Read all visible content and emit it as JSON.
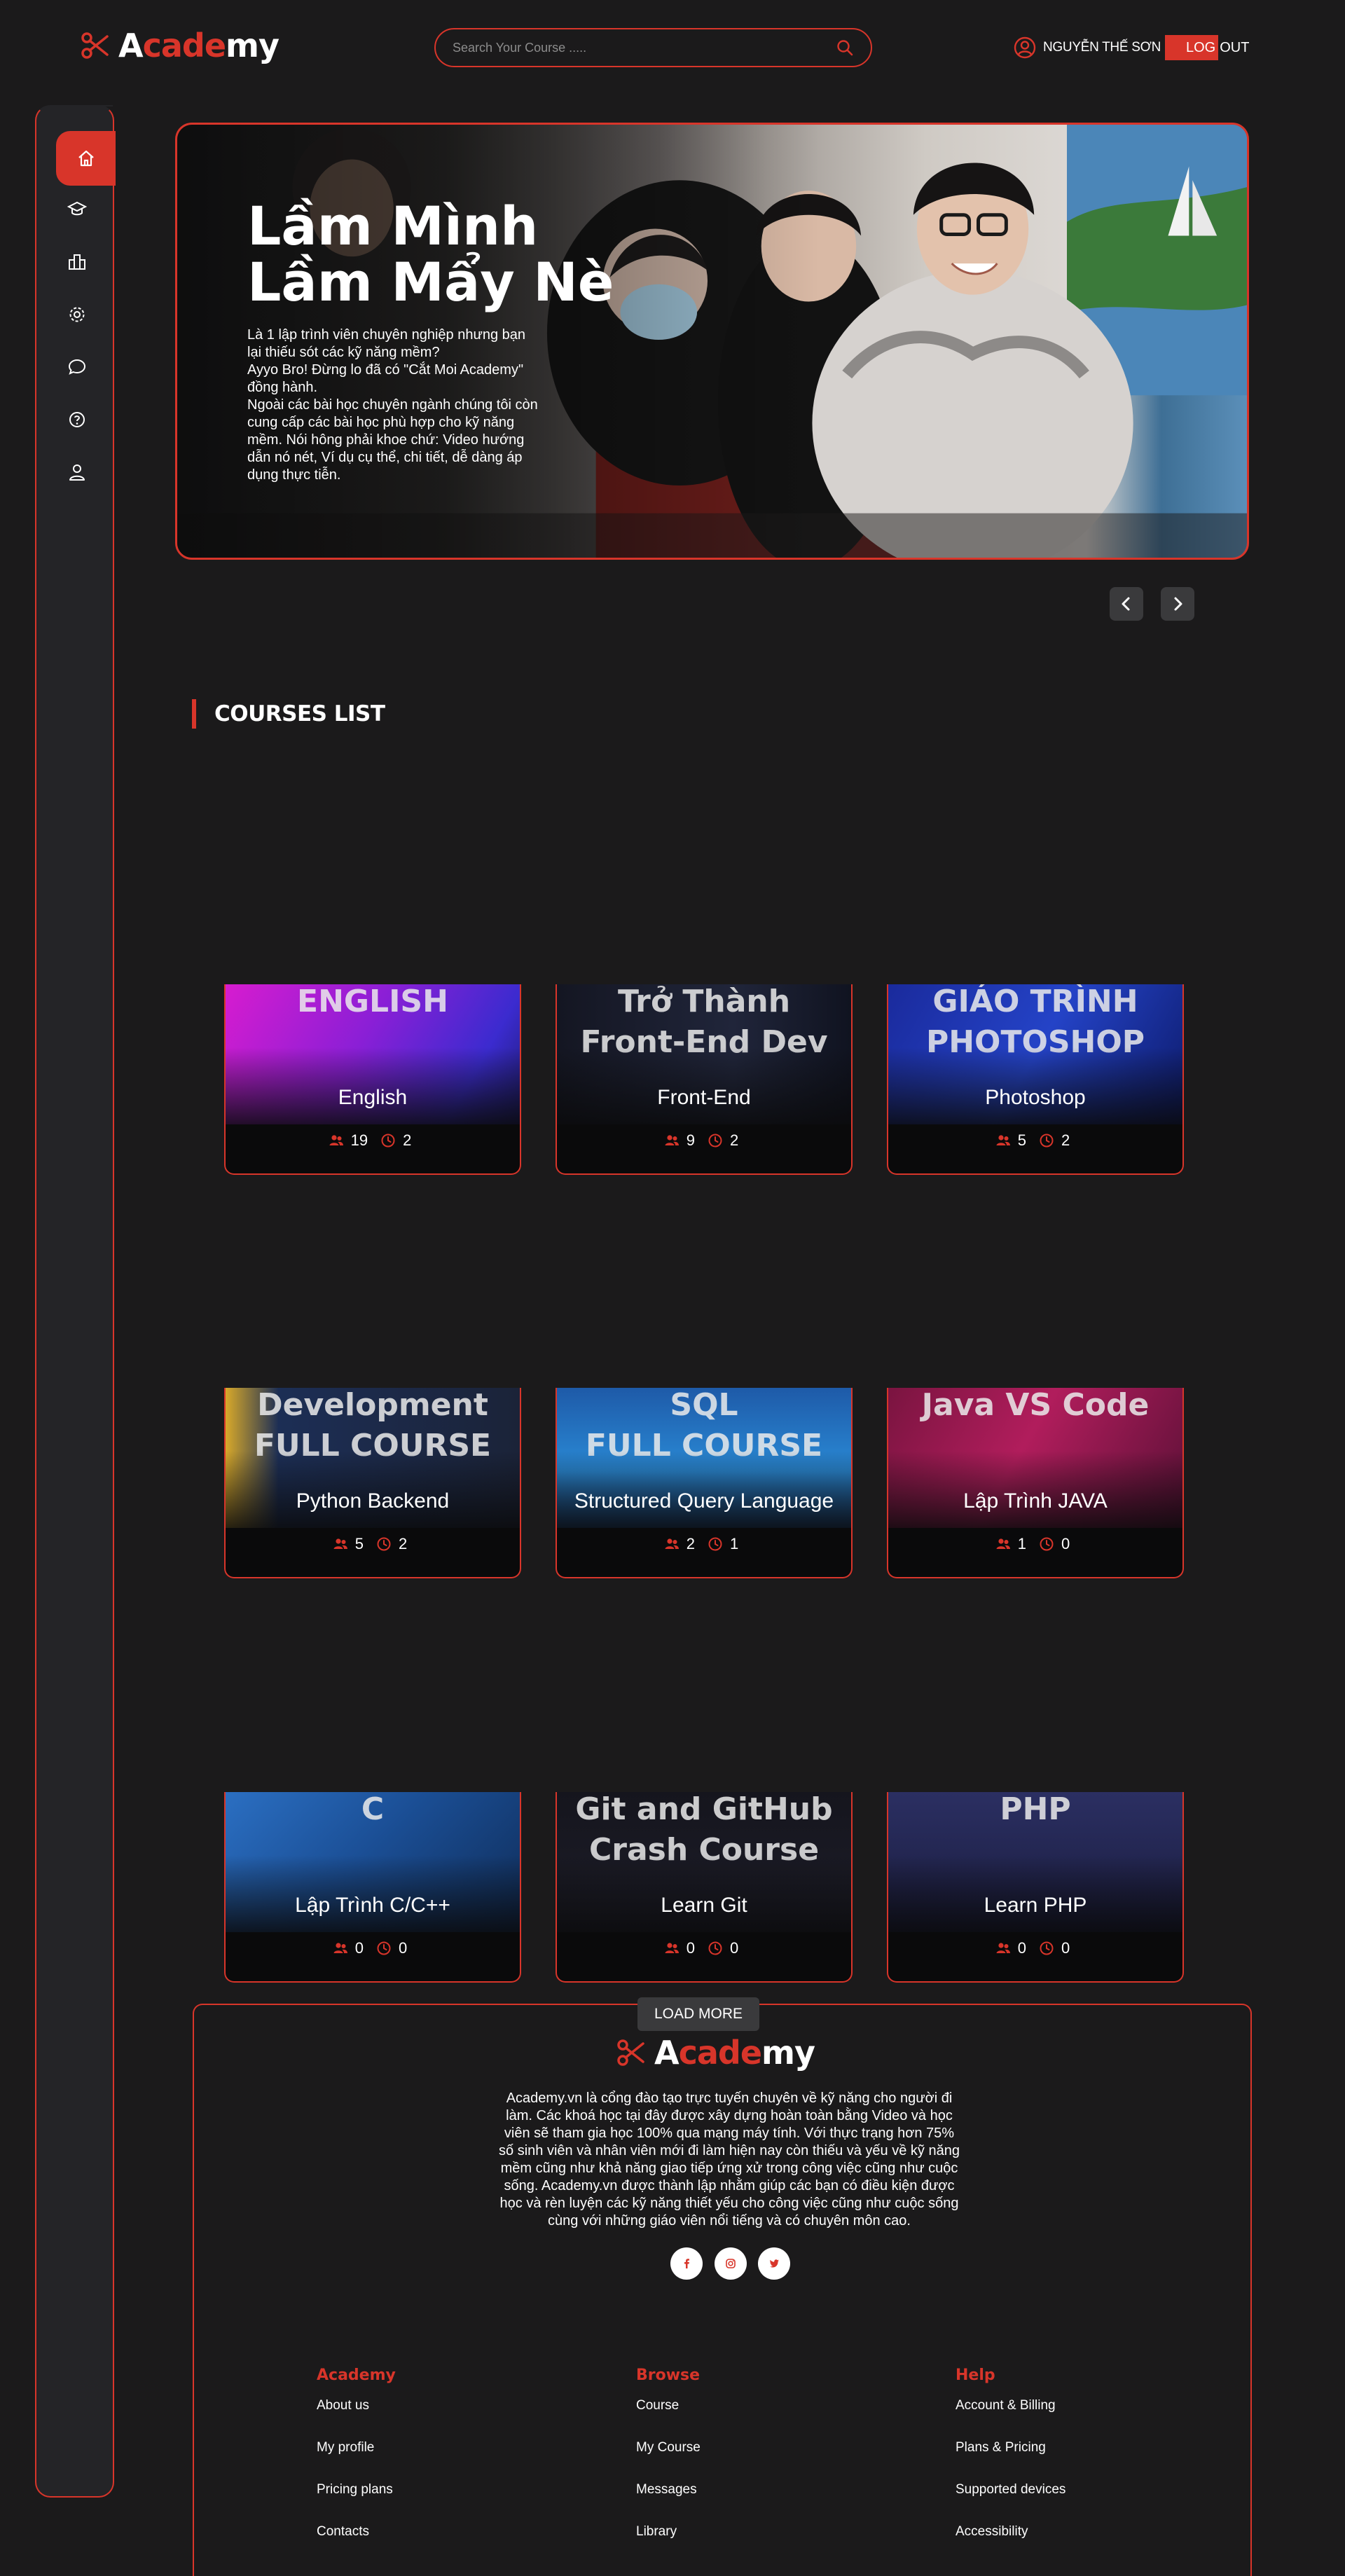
{
  "brand": {
    "part1": "A",
    "part2": "cade",
    "part3": "my"
  },
  "search": {
    "placeholder": "Search Your Course ....."
  },
  "user": {
    "name": "NGUYỄN THẾ SƠN",
    "logout_part1": "LOG",
    "logout_part2": "OUT"
  },
  "sidebar": {
    "items": [
      {
        "name": "home",
        "icon": "home-icon",
        "active": true
      },
      {
        "name": "courses",
        "icon": "graduation-cap-icon"
      },
      {
        "name": "institution",
        "icon": "building-icon"
      },
      {
        "name": "settings",
        "icon": "gear-icon"
      },
      {
        "name": "messages",
        "icon": "chat-icon"
      },
      {
        "name": "help",
        "icon": "question-icon"
      },
      {
        "name": "profile",
        "icon": "user-icon"
      }
    ]
  },
  "hero": {
    "title_line1": "Lầm Mình",
    "title_line2": "Lầm Mẩy Nè",
    "desc_lines": [
      "Là 1 lập trình viên chuyên nghiệp nhưng bạn",
      "lại thiếu sót các kỹ năng mềm?",
      "Ayyo Bro! Đừng lo đã có \"Cắt Moi Academy\"",
      "đồng hành.",
      "Ngoài các bài học chuyên ngành chúng tôi còn",
      "cung cấp các bài học phù hợp cho kỹ năng",
      "mềm. Nói hông phải khoe chứ: Video hướng",
      "dẫn nó nét, Ví dụ cụ thể, chi tiết, dễ dàng áp",
      "dụng thực tiễn."
    ]
  },
  "courses": {
    "title": "COURSES LIST",
    "items": [
      {
        "name": "English",
        "students": "19",
        "lessons": "2",
        "art": "ENGLISH",
        "bg": "linear-gradient(120deg,#d71ccf 0%,#8a1fd6 45%,#3b2bcf 80%,#1e1c73 100%)"
      },
      {
        "name": "Front-End",
        "students": "9",
        "lessons": "2",
        "art": "Trở Thành\nFront-End Dev",
        "bg": "linear-gradient(90deg,#141622 0%,#20253a 60%,#101320 100%)"
      },
      {
        "name": "Photoshop",
        "students": "5",
        "lessons": "2",
        "art": "GIÁO TRÌNH\nPHOTOSHOP",
        "bg": "linear-gradient(120deg,#1a2a9c 0%,#2443c7 50%,#0d1a6a 100%)"
      },
      {
        "name": "Python Backend",
        "students": "5",
        "lessons": "2",
        "art": "Development\nFULL COURSE",
        "bg": "linear-gradient(90deg,#d8a92a 0%,#1c2e55 18%,#1b2338 100%)"
      },
      {
        "name": "Structured Query Language",
        "students": "2",
        "lessons": "1",
        "art": "SQL\nFULL COURSE",
        "bg": "linear-gradient(180deg,#1e5aa8 0%,#2a8ad6 60%,#1b4d8a 100%)"
      },
      {
        "name": "Lập Trình JAVA",
        "students": "1",
        "lessons": "0",
        "art": "Java   VS Code",
        "bg": "linear-gradient(120deg,#7a1440 0%,#b11d5c 45%,#5a1036 100%)"
      },
      {
        "name": "Lập Trình C/C++",
        "students": "0",
        "lessons": "0",
        "art": "C",
        "bg": "linear-gradient(135deg,#2b6fc2 0%,#1b4f96 45%,#0f2c58 100%)"
      },
      {
        "name": "Learn Git",
        "students": "0",
        "lessons": "0",
        "art": "Git and GitHub\nCrash Course",
        "bg": "linear-gradient(180deg,#15151d 0%,#1e1e2a 100%)"
      },
      {
        "name": "Learn PHP",
        "students": "0",
        "lessons": "0",
        "art": "PHP",
        "bg": "linear-gradient(180deg,#2b2f62 0%,#1a1c3e 100%)"
      }
    ],
    "load_more": "LOAD MORE"
  },
  "footer": {
    "description_lines": [
      "Academy.vn là cổng đào tạo trực tuyến chuyên về kỹ năng cho người đi",
      "làm. Các khoá học tại đây được xây dựng hoàn toàn bằng Video và học",
      "viên sẽ tham gia học 100% qua mạng máy tính. Với thực trạng hơn 75%",
      "số sinh viên và nhân viên mới đi làm hiện nay còn thiếu và yếu về kỹ năng",
      "mềm cũng như khả năng giao tiếp ứng xử trong công việc cũng như cuộc",
      "sống. Academy.vn được thành lập nhằm giúp các bạn có điều kiện được",
      "học và rèn luyện các kỹ năng thiết yếu cho công việc cũng như cuộc sống",
      "cùng với những giáo viên nổi tiếng và có chuyên môn cao."
    ],
    "social": [
      {
        "name": "facebook",
        "icon": "facebook-icon"
      },
      {
        "name": "instagram",
        "icon": "instagram-icon"
      },
      {
        "name": "twitter",
        "icon": "twitter-icon"
      }
    ],
    "columns": [
      {
        "title": "Academy",
        "links": [
          "About us",
          "My profile",
          "Pricing plans",
          "Contacts"
        ]
      },
      {
        "title": "Browse",
        "links": [
          "Course",
          "My Course",
          "Messages",
          "Library"
        ]
      },
      {
        "title": "Help",
        "links": [
          "Account & Billing",
          "Plans & Pricing",
          "Supported devices",
          "Accessibility"
        ]
      }
    ]
  },
  "colors": {
    "accent": "#d8352a",
    "background": "#1b1a1b",
    "sidebar": "#242427"
  }
}
